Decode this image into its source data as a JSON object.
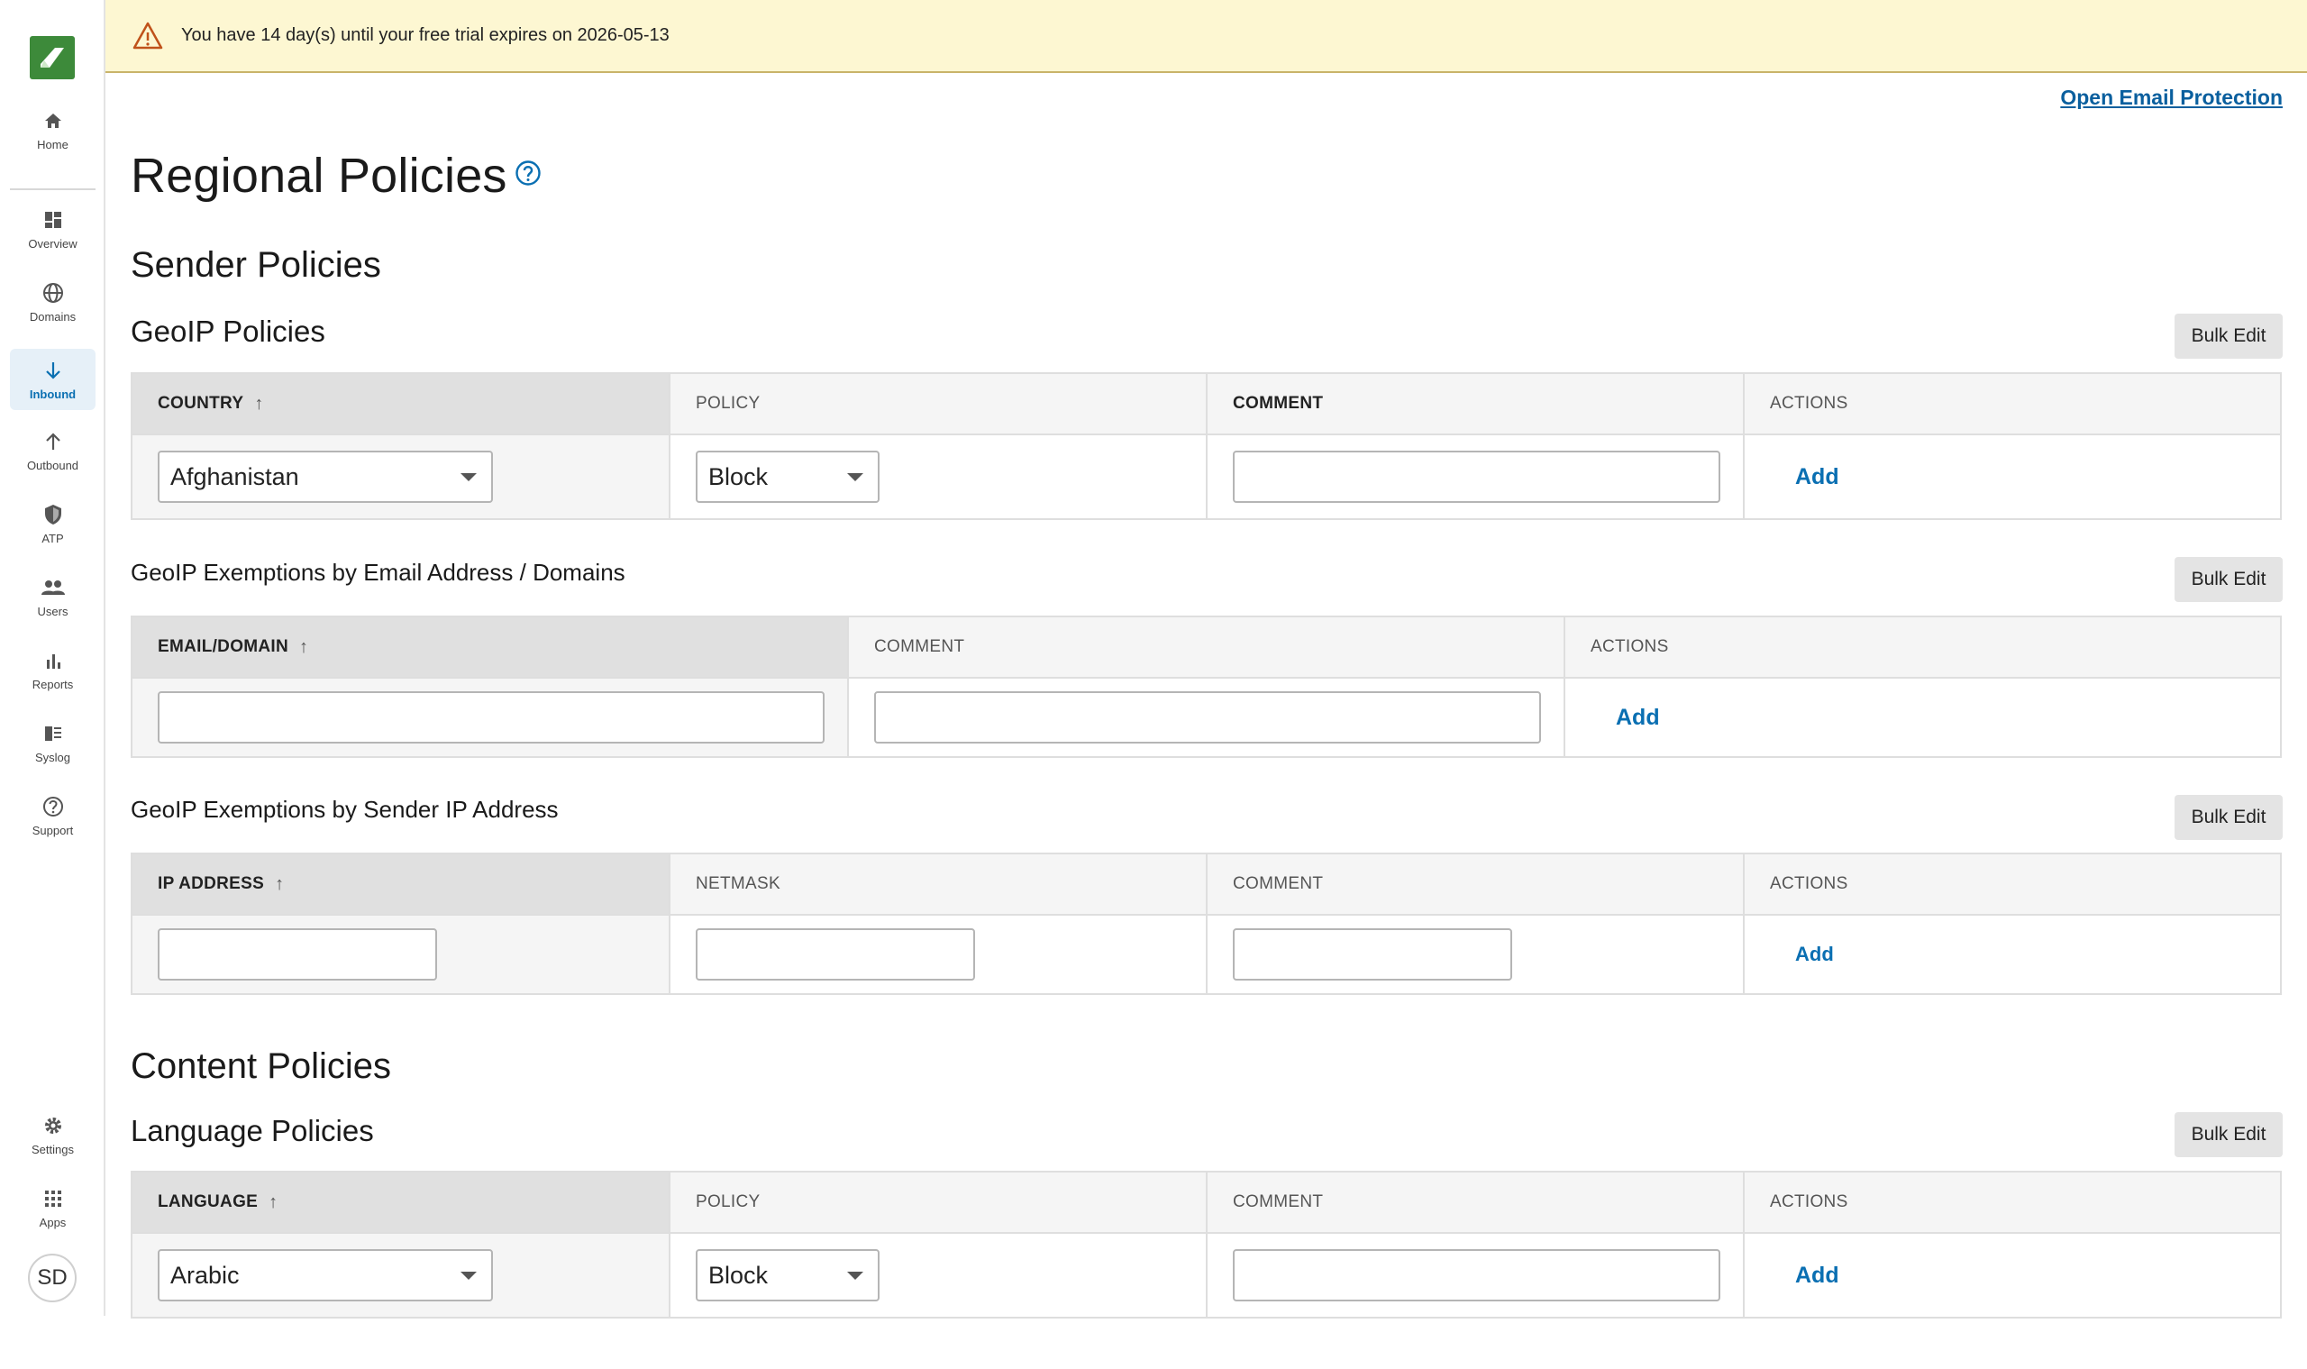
{
  "banner": {
    "message": "You have 14 day(s) until your free trial expires on 2026-05-13"
  },
  "header": {
    "open_link": "Open Email Protection"
  },
  "page": {
    "title": "Regional Policies"
  },
  "sidebar": {
    "items": [
      {
        "label": "Home",
        "icon": "home-icon"
      },
      {
        "label": "Overview",
        "icon": "overview-icon"
      },
      {
        "label": "Domains",
        "icon": "globe-icon"
      },
      {
        "label": "Inbound",
        "icon": "arrow-down-icon",
        "active": true
      },
      {
        "label": "Outbound",
        "icon": "arrow-up-icon"
      },
      {
        "label": "ATP",
        "icon": "shield-icon"
      },
      {
        "label": "Users",
        "icon": "users-icon"
      },
      {
        "label": "Reports",
        "icon": "bar-chart-icon"
      },
      {
        "label": "Syslog",
        "icon": "syslog-icon"
      },
      {
        "label": "Support",
        "icon": "help-circle-icon"
      }
    ],
    "bottom": [
      {
        "label": "Settings",
        "icon": "gear-icon"
      },
      {
        "label": "Apps",
        "icon": "grid-icon"
      }
    ],
    "avatar": "SD"
  },
  "sender": {
    "title": "Sender Policies",
    "geoip": {
      "title": "GeoIP Policies",
      "bulk": "Bulk Edit",
      "headers": [
        "COUNTRY",
        "POLICY",
        "COMMENT",
        "ACTIONS"
      ],
      "country": "Afghanistan",
      "policy": "Block",
      "add": "Add"
    },
    "email_exempt": {
      "title": "GeoIP Exemptions by Email Address / Domains",
      "bulk": "Bulk Edit",
      "headers": [
        "EMAIL/DOMAIN",
        "COMMENT",
        "ACTIONS"
      ],
      "add": "Add"
    },
    "ip_exempt": {
      "title": "GeoIP Exemptions by Sender IP Address",
      "bulk": "Bulk Edit",
      "headers": [
        "IP ADDRESS",
        "NETMASK",
        "COMMENT",
        "ACTIONS"
      ],
      "add": "Add"
    }
  },
  "content": {
    "title": "Content Policies",
    "language": {
      "title": "Language Policies",
      "bulk": "Bulk Edit",
      "headers": [
        "LANGUAGE",
        "POLICY",
        "COMMENT",
        "ACTIONS"
      ],
      "language": "Arabic",
      "policy": "Block",
      "add": "Add"
    }
  },
  "colors": {
    "accent": "#0a6fb2",
    "brand": "#3d8a3a",
    "banner": "#fdf7d2"
  }
}
